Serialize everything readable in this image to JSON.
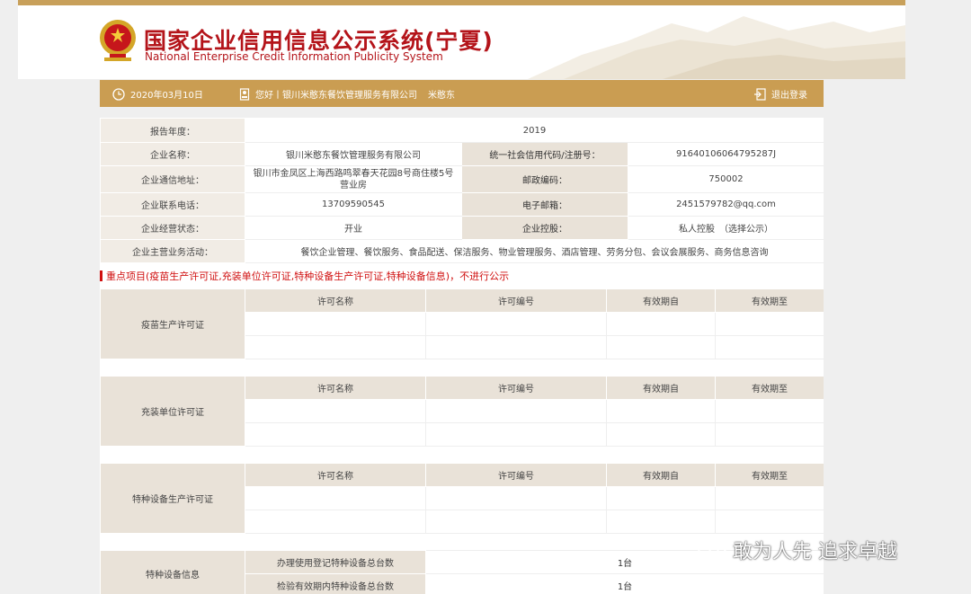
{
  "header": {
    "title_cn": "国家企业信用信息公示系统(宁夏)",
    "title_en": "National Enterprise Credit Information Publicity System"
  },
  "bar": {
    "date": "2020年03月10日",
    "greeting": "您好丨银川米憨东餐饮管理服务有限公司",
    "user": "米憨东",
    "logout": "退出登录"
  },
  "info": {
    "report_year_label": "报告年度：",
    "report_year": "2019",
    "company_name_label": "企业名称：",
    "company_name": "银川米憨东餐饮管理服务有限公司",
    "credit_code_label": "统一社会信用代码/注册号：",
    "credit_code": "91640106064795287J",
    "address_label": "企业通信地址：",
    "address": "银川市金凤区上海西路鸣翠春天花园8号商住楼5号营业房",
    "postcode_label": "邮政编码：",
    "postcode": "750002",
    "phone_label": "企业联系电话：",
    "phone": "13709590545",
    "email_label": "电子邮箱：",
    "email": "2451579782@qq.com",
    "status_label": "企业经营状态：",
    "status": "开业",
    "holding_label": "企业控股：",
    "holding": "私人控股　（选择公示）",
    "business_label": "企业主营业务活动：",
    "business": "餐饮企业管理、餐饮服务、食品配送、保洁服务、物业管理服务、酒店管理、劳务分包、会议会展服务、商务信息咨询"
  },
  "section_title": "重点项目(疫苗生产许可证,充装单位许可证,特种设备生产许可证,特种设备信息)，不进行公示",
  "permit_columns": [
    "许可名称",
    "许可编号",
    "有效期自",
    "有效期至"
  ],
  "permits": [
    {
      "name": "疫苗生产许可证"
    },
    {
      "name": "充装单位许可证"
    },
    {
      "name": "特种设备生产许可证"
    }
  ],
  "equipment": {
    "label": "特种设备信息",
    "row1_label": "办理使用登记特种设备总台数",
    "row1_value": "1台",
    "row2_label": "检验有效期内特种设备总台数",
    "row2_value": "1台"
  },
  "watermark": "敢为人先 追求卓越",
  "colors": {
    "accent": "#ca9d52",
    "title": "#b4141a",
    "label_bg": "#f1ece5"
  }
}
